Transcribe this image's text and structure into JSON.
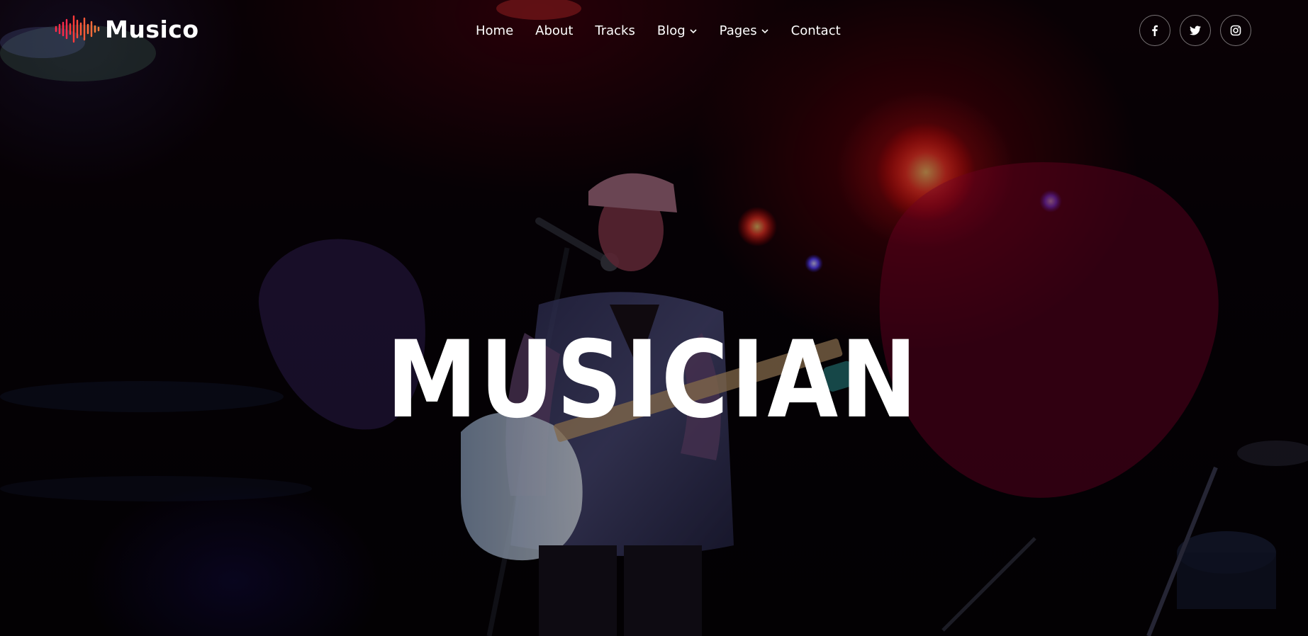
{
  "brand": {
    "name": "Musico",
    "accent": "#e8173a"
  },
  "nav": {
    "items": [
      {
        "label": "Home",
        "has_dropdown": false
      },
      {
        "label": "About",
        "has_dropdown": false
      },
      {
        "label": "Tracks",
        "has_dropdown": false
      },
      {
        "label": "Blog",
        "has_dropdown": true
      },
      {
        "label": "Pages",
        "has_dropdown": true
      },
      {
        "label": "Contact",
        "has_dropdown": false
      }
    ]
  },
  "social": [
    {
      "icon": "facebook-icon"
    },
    {
      "icon": "twitter-icon"
    },
    {
      "icon": "instagram-icon"
    }
  ],
  "hero": {
    "headline": "MUSICIAN",
    "background": "stage photo of guitarist singing into microphone under red lights"
  }
}
